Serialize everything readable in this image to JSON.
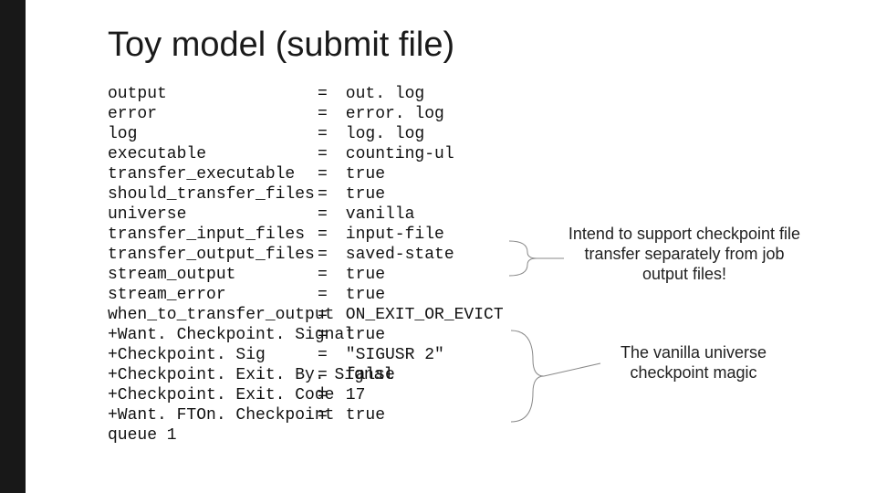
{
  "title": "Toy model (submit file)",
  "kv": [
    {
      "key": "output",
      "val": "out. log"
    },
    {
      "key": "error",
      "val": "error. log"
    },
    {
      "key": "log",
      "val": "log. log"
    },
    {
      "key": "executable",
      "val": "counting-ul"
    },
    {
      "key": "transfer_executable",
      "val": "true"
    },
    {
      "key": "should_transfer_files",
      "val": "true"
    },
    {
      "key": "universe",
      "val": "vanilla"
    },
    {
      "key": "transfer_input_files",
      "val": "input-file"
    },
    {
      "key": "transfer_output_files",
      "val": "saved-state"
    },
    {
      "key": "stream_output",
      "val": "true"
    },
    {
      "key": "stream_error",
      "val": "true"
    },
    {
      "key": "when_to_transfer_output",
      "val": "ON_EXIT_OR_EVICT"
    },
    {
      "key": "+Want. Checkpoint. Signal",
      "val": "true"
    },
    {
      "key": "+Checkpoint. Sig",
      "val": "\"SIGUSR 2\""
    },
    {
      "key": "+Checkpoint. Exit. By. Signal",
      "val": "false"
    },
    {
      "key": "+Checkpoint. Exit. Code",
      "val": "17"
    },
    {
      "key": "+Want. FTOn. Checkpoint",
      "val": "true"
    }
  ],
  "tail": "queue 1",
  "notes": {
    "n1": "Intend to support checkpoint file transfer separately from job output files!",
    "n2": "The vanilla universe checkpoint magic"
  }
}
